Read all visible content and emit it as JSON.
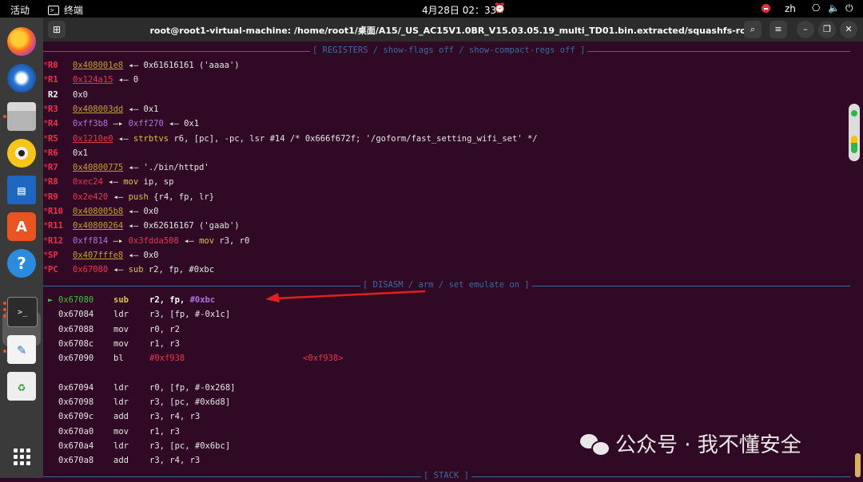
{
  "topbar": {
    "activities": "活动",
    "app_name": "终端",
    "clock": "4月28日 02：33",
    "lang": "zh"
  },
  "window": {
    "title": "root@root1-virtual-machine: /home/root1/桌面/A15/_US_AC15V1.0BR_V15.03.05.19_multi_TD01.bin.extracted/squashfs-root"
  },
  "sections": {
    "registers": "[ REGISTERS / show-flags off / show-compact-regs off ]",
    "disasm": "[ DISASM / arm / set emulate on ]",
    "stack": "[ STACK ]"
  },
  "registers": [
    {
      "name": "R0",
      "changed": true,
      "parts": [
        {
          "t": "0x408001e8",
          "c": "c-stack u"
        },
        {
          "t": " ◂— 0x61616161 ('aaaa')",
          "c": "c-white"
        }
      ]
    },
    {
      "name": "R1",
      "changed": true,
      "parts": [
        {
          "t": "0x124a15",
          "c": "c-code u"
        },
        {
          "t": " ◂— 0",
          "c": "c-white"
        }
      ]
    },
    {
      "name": "R2",
      "changed": false,
      "parts": [
        {
          "t": "0x0",
          "c": "c-white"
        }
      ]
    },
    {
      "name": "R3",
      "changed": true,
      "parts": [
        {
          "t": "0x408003dd",
          "c": "c-stack u"
        },
        {
          "t": " ◂— 0x1",
          "c": "c-white"
        }
      ]
    },
    {
      "name": "R4",
      "changed": true,
      "parts": [
        {
          "t": "0xff3b8",
          "c": "c-purple"
        },
        {
          "t": " —▸ ",
          "c": "c-white"
        },
        {
          "t": "0xff270",
          "c": "c-purple"
        },
        {
          "t": " ◂— 0x1",
          "c": "c-white"
        }
      ]
    },
    {
      "name": "R5",
      "changed": true,
      "parts": [
        {
          "t": "0x1210e0",
          "c": "c-code u"
        },
        {
          "t": " ◂— ",
          "c": "c-white"
        },
        {
          "t": "strbtvs",
          "c": "c-mn"
        },
        {
          "t": " r6, [pc], -pc, lsr #14 /* 0x666f672f; '/goform/fast_setting_wifi_set' */",
          "c": "c-white"
        }
      ]
    },
    {
      "name": "R6",
      "changed": true,
      "parts": [
        {
          "t": "0x1",
          "c": "c-white"
        }
      ]
    },
    {
      "name": "R7",
      "changed": true,
      "parts": [
        {
          "t": "0x40800775",
          "c": "c-stack u"
        },
        {
          "t": " ◂— './bin/httpd'",
          "c": "c-white"
        }
      ]
    },
    {
      "name": "R8",
      "changed": true,
      "parts": [
        {
          "t": "0xec24",
          "c": "c-code"
        },
        {
          "t": " ◂— ",
          "c": "c-white"
        },
        {
          "t": "mov",
          "c": "c-mn"
        },
        {
          "t": " ip, sp",
          "c": "c-white"
        }
      ]
    },
    {
      "name": "R9",
      "changed": true,
      "parts": [
        {
          "t": "0x2e420",
          "c": "c-code"
        },
        {
          "t": " ◂— ",
          "c": "c-white"
        },
        {
          "t": "push",
          "c": "c-mn"
        },
        {
          "t": " {r4, fp, lr}",
          "c": "c-white"
        }
      ]
    },
    {
      "name": "R10",
      "changed": true,
      "parts": [
        {
          "t": "0x408005b8",
          "c": "c-stack u"
        },
        {
          "t": " ◂— 0x0",
          "c": "c-white"
        }
      ]
    },
    {
      "name": "R11",
      "changed": true,
      "parts": [
        {
          "t": "0x40800264",
          "c": "c-stack u"
        },
        {
          "t": " ◂— 0x62616167 ('gaab')",
          "c": "c-white"
        }
      ]
    },
    {
      "name": "R12",
      "changed": true,
      "parts": [
        {
          "t": "0xff814",
          "c": "c-purple"
        },
        {
          "t": " —▸ ",
          "c": "c-white"
        },
        {
          "t": "0x3fdda508",
          "c": "c-code"
        },
        {
          "t": " ◂— ",
          "c": "c-white"
        },
        {
          "t": "mov",
          "c": "c-mn"
        },
        {
          "t": " r3, r0",
          "c": "c-white"
        }
      ]
    },
    {
      "name": "SP",
      "changed": true,
      "parts": [
        {
          "t": "0x407fffe8",
          "c": "c-stack u"
        },
        {
          "t": " ◂— 0x0",
          "c": "c-white"
        }
      ]
    },
    {
      "name": "PC",
      "changed": true,
      "parts": [
        {
          "t": "0x67080",
          "c": "c-code"
        },
        {
          "t": " ◂— ",
          "c": "c-white"
        },
        {
          "t": "sub",
          "c": "c-mn"
        },
        {
          "t": " r2, fp, #0xbc",
          "c": "c-white"
        }
      ]
    }
  ],
  "disasm": [
    {
      "addr": "0x67080",
      "mn": "sub",
      "ops": "r2, fp, #0xbc",
      "current": true
    },
    {
      "addr": "0x67084",
      "mn": "ldr",
      "ops": "r3, [fp, #-0x1c]"
    },
    {
      "addr": "0x67088",
      "mn": "mov",
      "ops": "r0, r2"
    },
    {
      "addr": "0x6708c",
      "mn": "mov",
      "ops": "r1, r3"
    },
    {
      "addr": "0x67090",
      "mn": "bl",
      "ops": "#0xf938",
      "target": "<0xf938>"
    },
    {
      "addr": "",
      "mn": "",
      "ops": ""
    },
    {
      "addr": "0x67094",
      "mn": "ldr",
      "ops": "r0, [fp, #-0x268]"
    },
    {
      "addr": "0x67098",
      "mn": "ldr",
      "ops": "r3, [pc, #0x6d8]"
    },
    {
      "addr": "0x6709c",
      "mn": "add",
      "ops": "r3, r4, r3"
    },
    {
      "addr": "0x670a0",
      "mn": "mov",
      "ops": "r1, r3"
    },
    {
      "addr": "0x670a4",
      "mn": "ldr",
      "ops": "r3, [pc, #0x6bc]"
    },
    {
      "addr": "0x670a8",
      "mn": "add",
      "ops": "r3, r4, r3"
    }
  ],
  "watermark": "公众号 · 我不懂安全",
  "colors": {
    "bg": "#300a24",
    "accent_red": "#e8334e",
    "green": "#40c040",
    "yellow": "#e0c040",
    "sep": "#3b6aa0"
  }
}
